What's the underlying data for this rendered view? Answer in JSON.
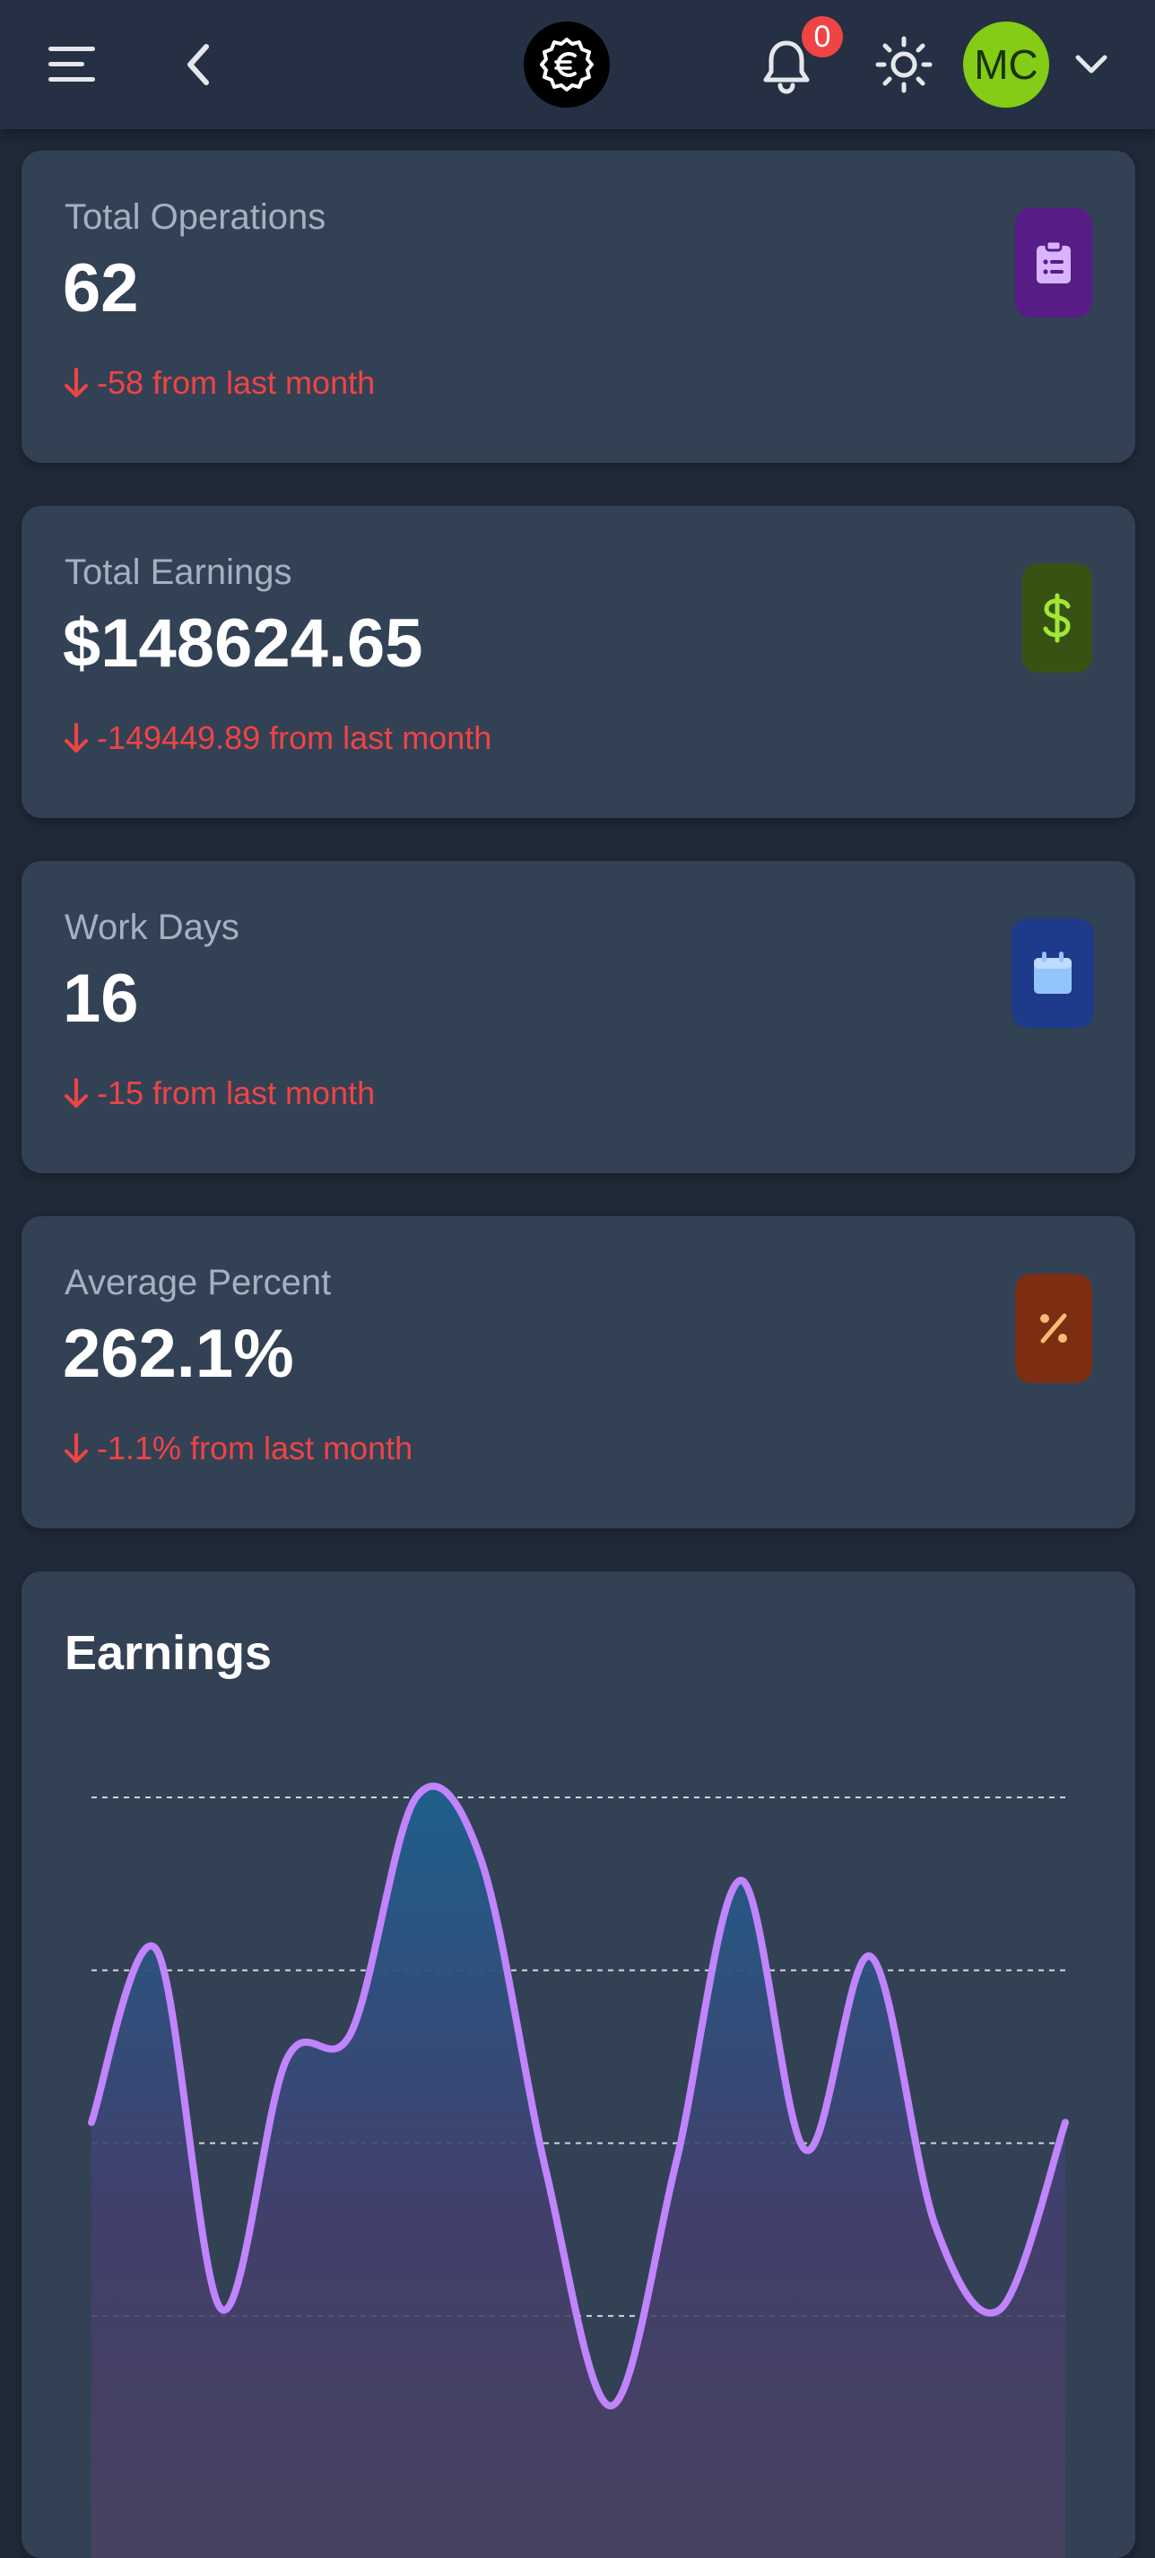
{
  "header": {
    "notification_count": "0",
    "avatar_initials": "MC",
    "icons": {
      "menu": "menu-icon",
      "back": "chevron-left-icon",
      "logo": "euro-seal-icon",
      "notifications": "bell-icon",
      "theme": "sun-icon",
      "account": "chevron-down-icon"
    }
  },
  "stats": [
    {
      "label": "Total Operations",
      "value": "62",
      "change": "-58 from last month",
      "icon": "clipboard-list-icon",
      "icon_bg": "#581c87",
      "icon_fg": "#d8b4fe"
    },
    {
      "label": "Total Earnings",
      "value": "$148624.65",
      "change": "-149449.89 from last month",
      "icon": "dollar-icon",
      "icon_bg": "#365314",
      "icon_fg": "#a3e635"
    },
    {
      "label": "Work Days",
      "value": "16",
      "change": "-15 from last month",
      "icon": "calendar-icon",
      "icon_bg": "#1e3a8a",
      "icon_fg": "#93c5fd"
    },
    {
      "label": "Average Percent",
      "value": "262.1%",
      "change": "-1.1% from last month",
      "icon": "percent-icon",
      "icon_bg": "#7c2d12",
      "icon_fg": "#fdba74"
    }
  ],
  "colors": {
    "background": "#1f2937",
    "card": "#334155",
    "negative": "#ef4444",
    "chart_line": "#c084fc"
  },
  "chart_data": {
    "type": "area",
    "title": "Earnings",
    "xlabel": "",
    "ylabel": "",
    "grid": true,
    "ylim": [
      0,
      100
    ],
    "x": [
      0,
      1,
      2,
      3,
      4,
      5,
      6,
      7,
      8,
      9,
      10,
      11,
      12,
      13,
      14,
      15
    ],
    "series": [
      {
        "values": [
          53,
          78,
          26,
          62,
          66,
          100,
          91,
          46,
          12,
          47,
          88,
          49,
          77,
          38,
          26,
          53
        ]
      }
    ]
  }
}
